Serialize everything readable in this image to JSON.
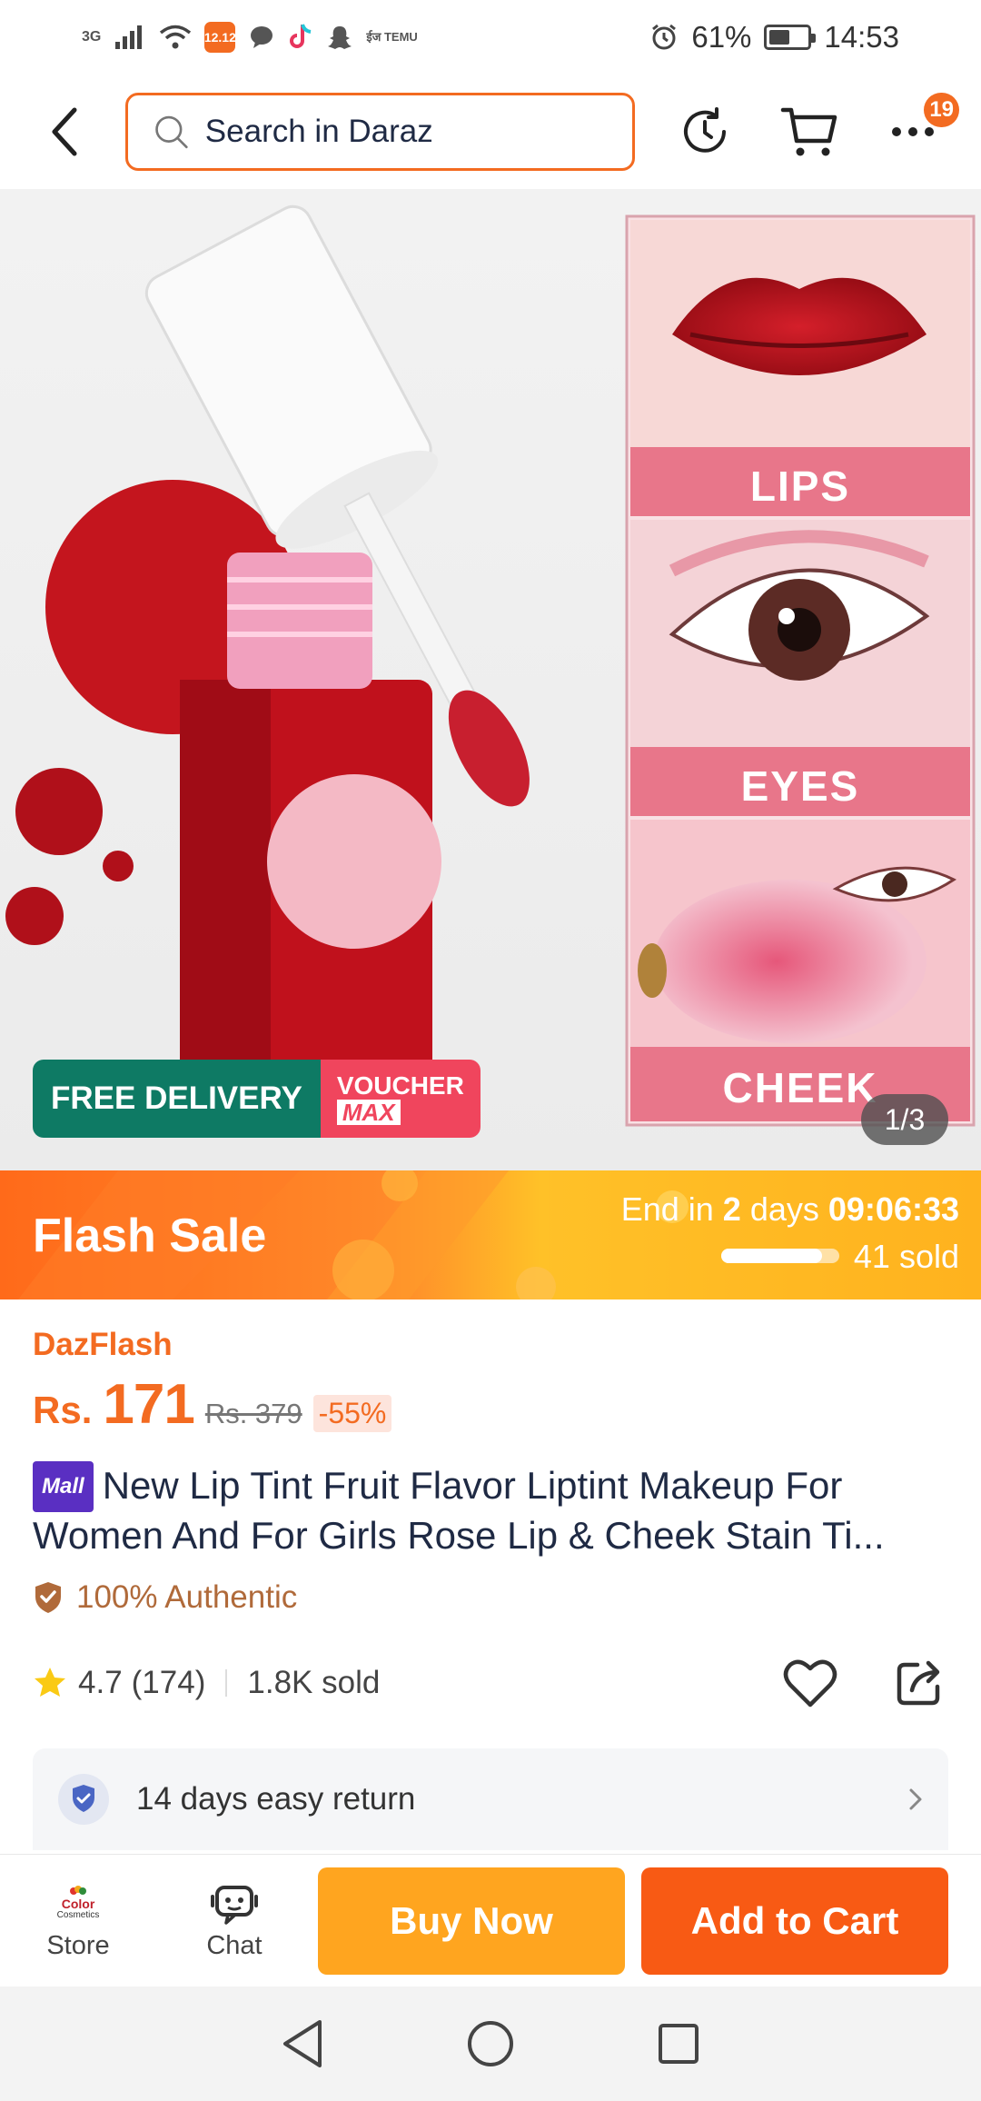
{
  "status_bar": {
    "network": "3G",
    "app_badge": "12.12",
    "temu_label": "ईज TEMU",
    "battery": "61%",
    "battery_level": 0.61,
    "time": "14:53"
  },
  "header": {
    "search_placeholder": "Search in Daraz",
    "more_badge": "19"
  },
  "gallery": {
    "lips_label": "LIPS",
    "eyes_label": "EYES",
    "cheek_label": "CHEEK",
    "free_delivery": "FREE DELIVERY",
    "voucher": "VOUCHER",
    "voucher_max": "MAX",
    "counter": "1/3"
  },
  "flash_sale": {
    "title": "Flash Sale",
    "end_prefix": "End in",
    "end_days": "2",
    "end_days_unit": "days",
    "end_time": "09:06:33",
    "sold": "41 sold",
    "sold_fraction": 0.85
  },
  "product": {
    "brand_tag": "DazFlash",
    "currency": "Rs.",
    "price": "171",
    "old_price": "Rs. 379",
    "discount": "-55%",
    "mall_badge": "Mall",
    "title": "New Lip Tint Fruit Flavor Liptint Makeup For Women And For Girls Rose Lip & Cheek Stain Ti...",
    "authentic": "100% Authentic",
    "rating": "4.7",
    "reviews": "(174)",
    "sold": "1.8K sold",
    "return_policy": "14 days easy return"
  },
  "action_bar": {
    "store_logo_top": "Color",
    "store_logo_bottom": "Cosmetics",
    "store_label": "Store",
    "chat_label": "Chat",
    "buy_now": "Buy Now",
    "add_to_cart": "Add to Cart"
  },
  "colors": {
    "accent": "#f36b21",
    "buy_now": "#ffa51f",
    "add_to_cart": "#f85a14",
    "free_delivery": "#0e7a64",
    "voucher": "#f0455d",
    "mall": "#5a2fc2"
  },
  "icons": {
    "back": "chevron-left-icon",
    "search": "search-icon",
    "history": "history-icon",
    "cart": "cart-icon",
    "more": "more-icon",
    "authentic": "shield-icon",
    "star": "star-icon",
    "wishlist": "heart-icon",
    "share": "share-icon",
    "return": "return-shield-icon",
    "chat": "chat-robot-icon"
  }
}
